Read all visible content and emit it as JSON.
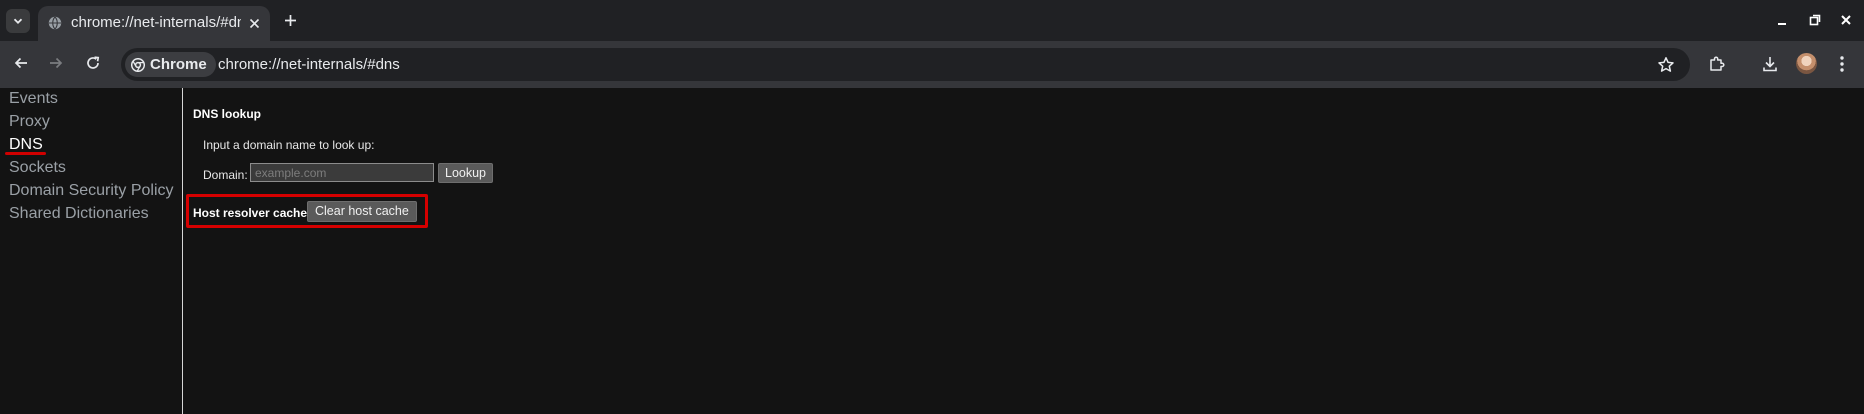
{
  "browser": {
    "tab": {
      "title": "chrome://net-internals/#dns",
      "close_glyph": "✕"
    },
    "new_tab_glyph": "+",
    "window_controls": {
      "minimize": "minimize-icon",
      "restore": "restore-icon",
      "close": "close-icon"
    },
    "omnibox": {
      "chip_label": "Chrome",
      "url": "chrome://net-internals/#dns"
    },
    "colors": {
      "tabstrip": "#202124",
      "toolbar": "#35363a",
      "page_bg": "#131313",
      "highlight": "#d60000"
    }
  },
  "sidebar": {
    "items": [
      {
        "label": "Events"
      },
      {
        "label": "Proxy"
      },
      {
        "label": "DNS",
        "selected": true
      },
      {
        "label": "Sockets"
      },
      {
        "label": "Domain Security Policy"
      },
      {
        "label": "Shared Dictionaries"
      }
    ]
  },
  "dns": {
    "lookup_heading": "DNS lookup",
    "prompt": "Input a domain name to look up:",
    "domain_label": "Domain:",
    "domain_value": "",
    "domain_placeholder": "example.com",
    "lookup_button": "Lookup",
    "host_cache_label": "Host resolver cache",
    "clear_cache_button": "Clear host cache"
  }
}
